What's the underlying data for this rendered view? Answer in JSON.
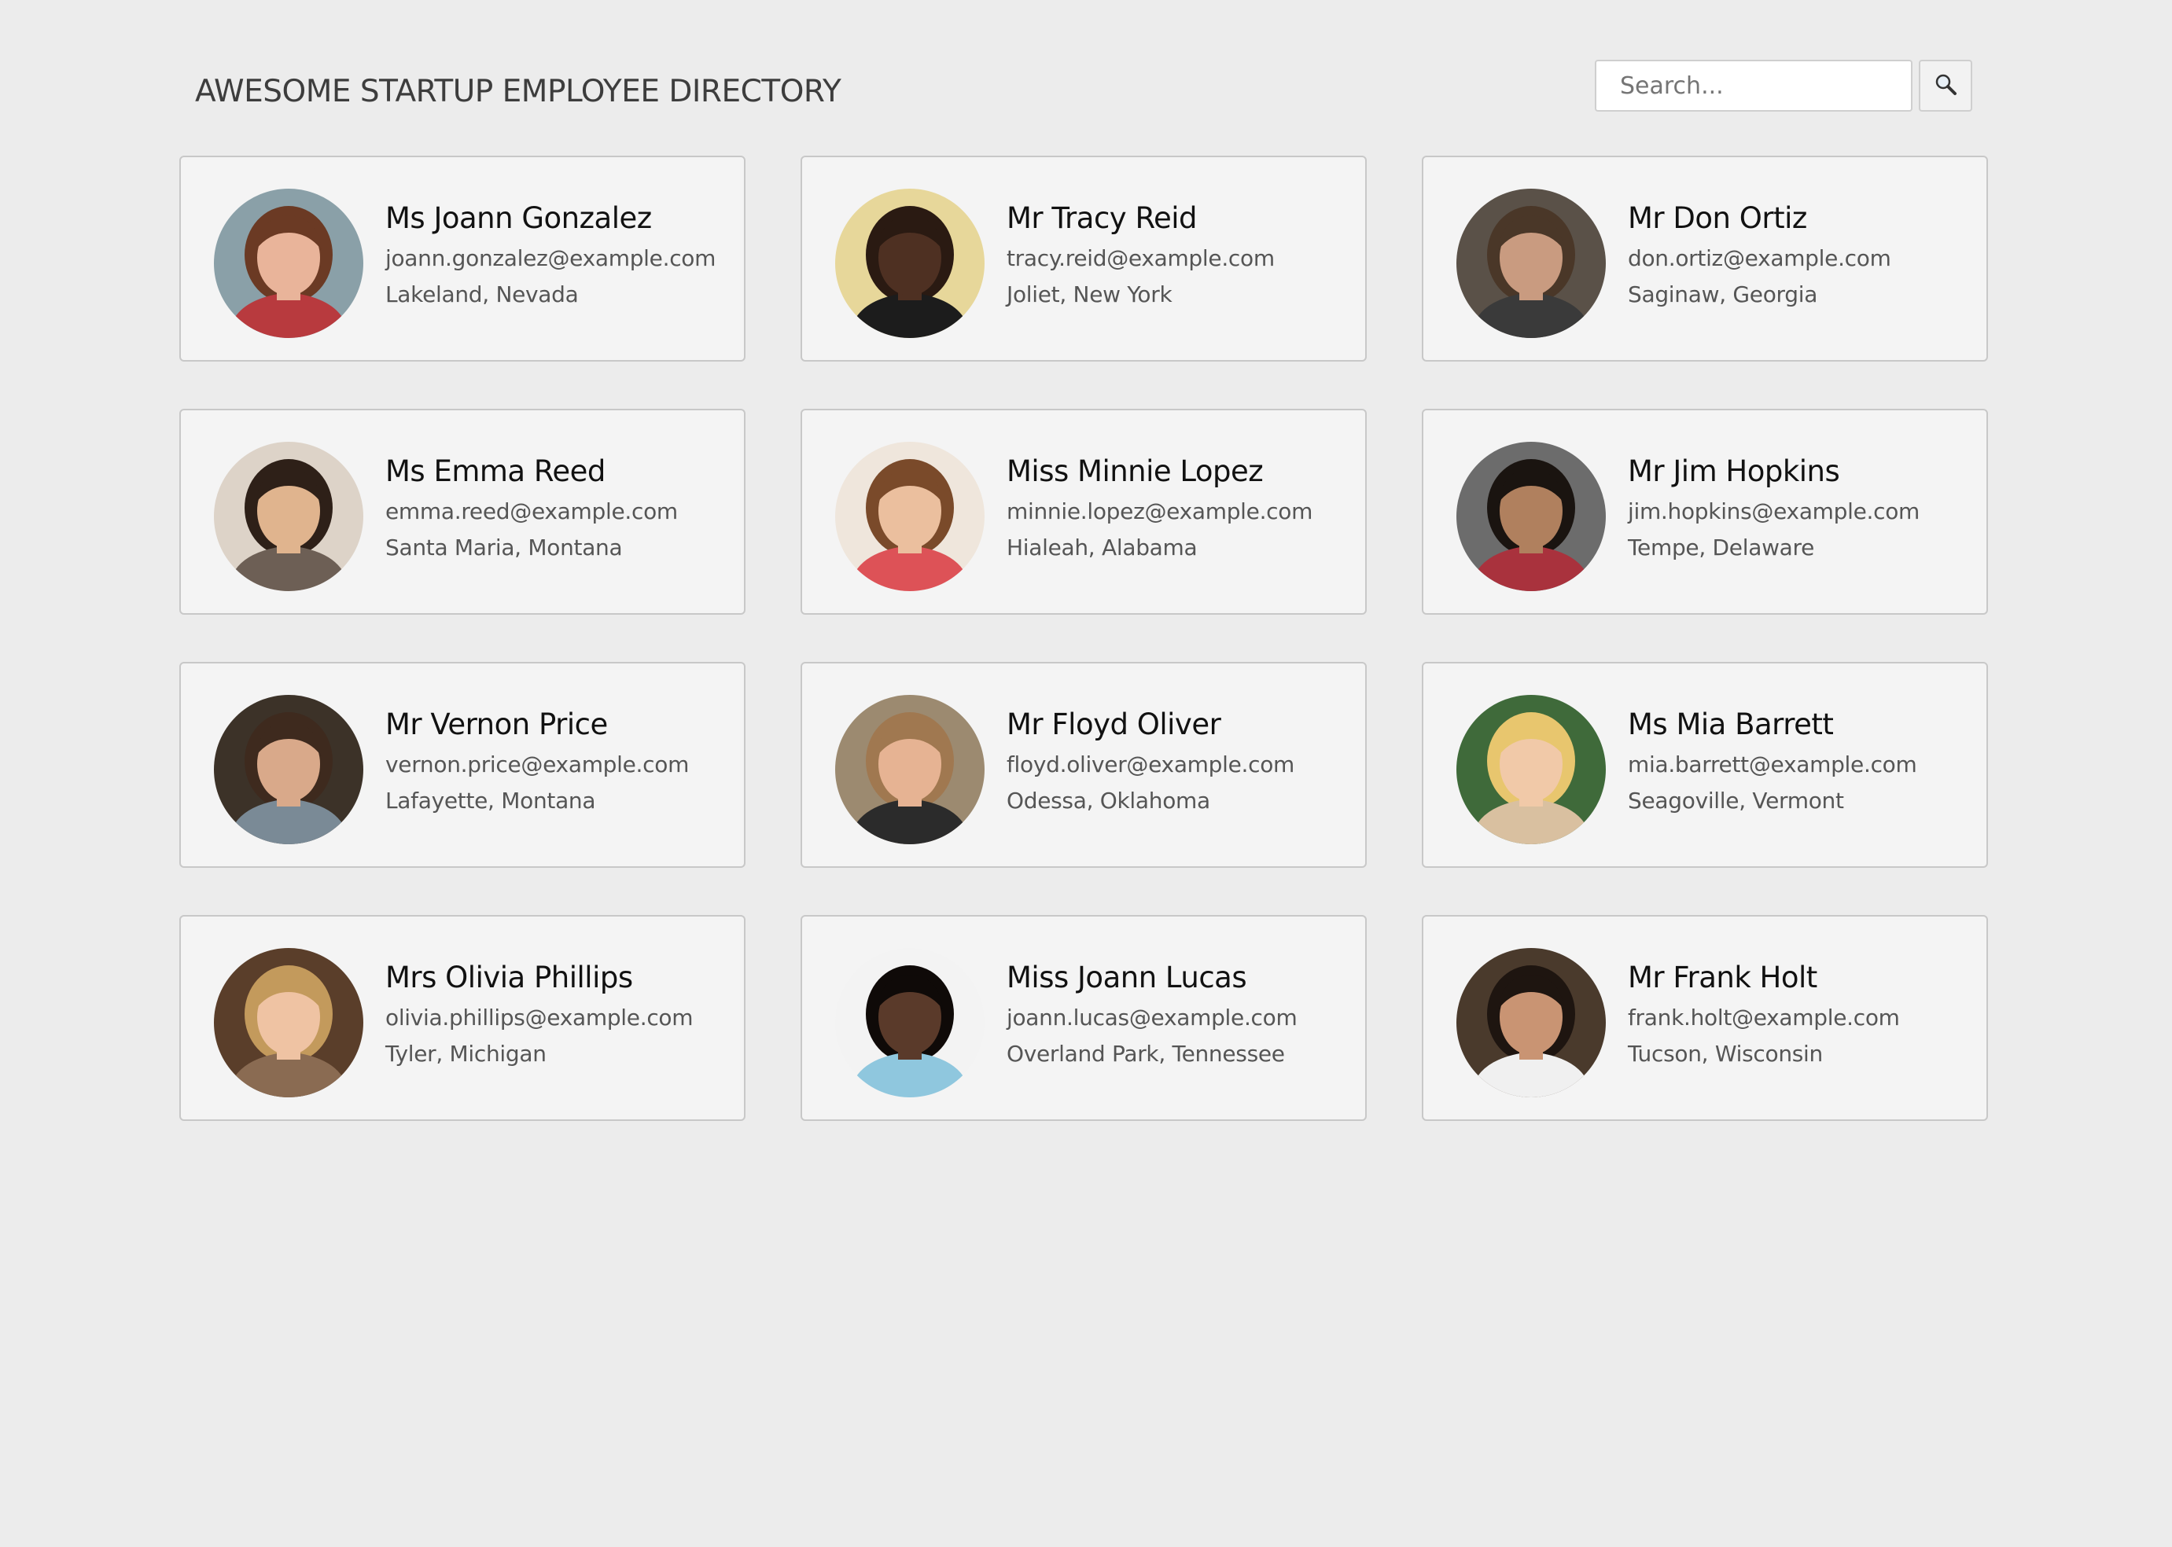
{
  "header": {
    "title": "AWESOME STARTUP EMPLOYEE DIRECTORY",
    "search_placeholder": "Search...",
    "search_value": "",
    "search_icon": "magnifying-glass-icon"
  },
  "employees": [
    {
      "name": "Ms Joann Gonzalez",
      "email": "joann.gonzalez@example.com",
      "location": "Lakeland, Nevada",
      "avatar": {
        "bg": "#8aa0a8",
        "skin": "#e9b49a",
        "hair": "#6b3a24",
        "shirt": "#b83a3e"
      }
    },
    {
      "name": "Mr Tracy Reid",
      "email": "tracy.reid@example.com",
      "location": "Joliet, New York",
      "avatar": {
        "bg": "#e7d79a",
        "skin": "#4e3022",
        "hair": "#2a1a12",
        "shirt": "#1c1c1c"
      }
    },
    {
      "name": "Mr Don Ortiz",
      "email": "don.ortiz@example.com",
      "location": "Saginaw, Georgia",
      "avatar": {
        "bg": "#5a5148",
        "skin": "#c99b80",
        "hair": "#4a3728",
        "shirt": "#3a3a3a"
      }
    },
    {
      "name": "Ms Emma Reed",
      "email": "emma.reed@example.com",
      "location": "Santa Maria, Montana",
      "avatar": {
        "bg": "#ddd3c8",
        "skin": "#e0b48e",
        "hair": "#2e2018",
        "shirt": "#6d5f55"
      }
    },
    {
      "name": "Miss Minnie Lopez",
      "email": "minnie.lopez@example.com",
      "location": "Hialeah, Alabama",
      "avatar": {
        "bg": "#efe6dc",
        "skin": "#ebbf9e",
        "hair": "#7a4a2a",
        "shirt": "#dd5257"
      }
    },
    {
      "name": "Mr Jim Hopkins",
      "email": "jim.hopkins@example.com",
      "location": "Tempe, Delaware",
      "avatar": {
        "bg": "#6c6c6c",
        "skin": "#b0805e",
        "hair": "#1a1410",
        "shirt": "#a9323d"
      }
    },
    {
      "name": "Mr Vernon Price",
      "email": "vernon.price@example.com",
      "location": "Lafayette, Montana",
      "avatar": {
        "bg": "#3c3228",
        "skin": "#d9a98a",
        "hair": "#3e2a1e",
        "shirt": "#7a8a96"
      }
    },
    {
      "name": "Mr Floyd Oliver",
      "email": "floyd.oliver@example.com",
      "location": "Odessa, Oklahoma",
      "avatar": {
        "bg": "#9c8a70",
        "skin": "#e6b393",
        "hair": "#a07850",
        "shirt": "#2b2b2b"
      }
    },
    {
      "name": "Ms Mia Barrett",
      "email": "mia.barrett@example.com",
      "location": "Seagoville, Vermont",
      "avatar": {
        "bg": "#3f6a3a",
        "skin": "#f1c9a8",
        "hair": "#e8c66e",
        "shirt": "#d9c0a0"
      }
    },
    {
      "name": "Mrs Olivia Phillips",
      "email": "olivia.phillips@example.com",
      "location": "Tyler, Michigan",
      "avatar": {
        "bg": "#5a3e2a",
        "skin": "#efc3a3",
        "hair": "#c39a5c",
        "shirt": "#8a6b52"
      }
    },
    {
      "name": "Miss Joann Lucas",
      "email": "joann.lucas@example.com",
      "location": "Overland Park, Tennessee",
      "avatar": {
        "bg": "#f3f3f3",
        "skin": "#5a3a2a",
        "hair": "#0f0a08",
        "shirt": "#8fc7de"
      }
    },
    {
      "name": "Mr Frank Holt",
      "email": "frank.holt@example.com",
      "location": "Tucson, Wisconsin",
      "avatar": {
        "bg": "#4a3a2c",
        "skin": "#c99473",
        "hair": "#1e1510",
        "shirt": "#f0f0f0"
      }
    }
  ]
}
